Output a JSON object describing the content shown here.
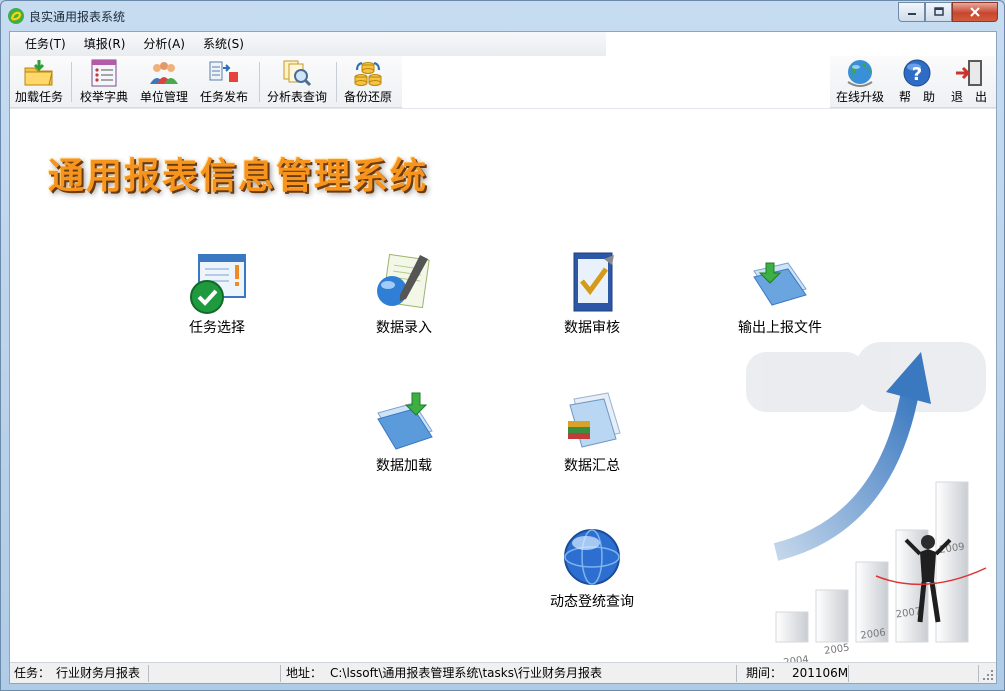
{
  "window": {
    "title": "良实通用报表系统"
  },
  "menu": [
    {
      "label": "任务(T)"
    },
    {
      "label": "填报(R)"
    },
    {
      "label": "分析(A)"
    },
    {
      "label": "系统(S)"
    }
  ],
  "toolbar": {
    "left": [
      {
        "label": "加载任务",
        "icon": "folder-load-icon"
      },
      {
        "label": "校举字典",
        "icon": "dictionary-icon"
      },
      {
        "label": "单位管理",
        "icon": "users-icon"
      },
      {
        "label": "任务发布",
        "icon": "publish-icon"
      },
      {
        "label": "分析表查询",
        "icon": "search-docs-icon"
      },
      {
        "label": "备份还原",
        "icon": "database-backup-icon"
      }
    ],
    "right": [
      {
        "label": "在线升级",
        "icon": "globe-icon"
      },
      {
        "label": "帮　助",
        "icon": "help-icon"
      },
      {
        "label": "退　出",
        "icon": "exit-icon"
      }
    ]
  },
  "banner": "通用报表信息管理系统",
  "functions": [
    {
      "label": "任务选择",
      "icon": "task-select-icon"
    },
    {
      "label": "数据录入",
      "icon": "data-entry-icon"
    },
    {
      "label": "数据审核",
      "icon": "data-audit-icon"
    },
    {
      "label": "输出上报文件",
      "icon": "export-file-icon"
    },
    {
      "label": "数据加载",
      "icon": "data-load-icon"
    },
    {
      "label": "数据汇总",
      "icon": "data-summary-icon"
    },
    {
      "label": "动态登统查询",
      "icon": "dynamic-query-icon"
    }
  ],
  "decoration": {
    "years": [
      "2004",
      "2005",
      "2006",
      "2007",
      "2009"
    ]
  },
  "status": {
    "task_label": "任务：",
    "task_value": "行业财务月报表",
    "addr_label": "地址：",
    "addr_value": "C:\\lssoft\\通用报表管理系统\\tasks\\行业财务月报表",
    "period_label": "期间：",
    "period_value": "201106M"
  },
  "colors": {
    "banner": "#f7941d",
    "titlebar": "#c7dcf1",
    "close": "#c7472e"
  }
}
